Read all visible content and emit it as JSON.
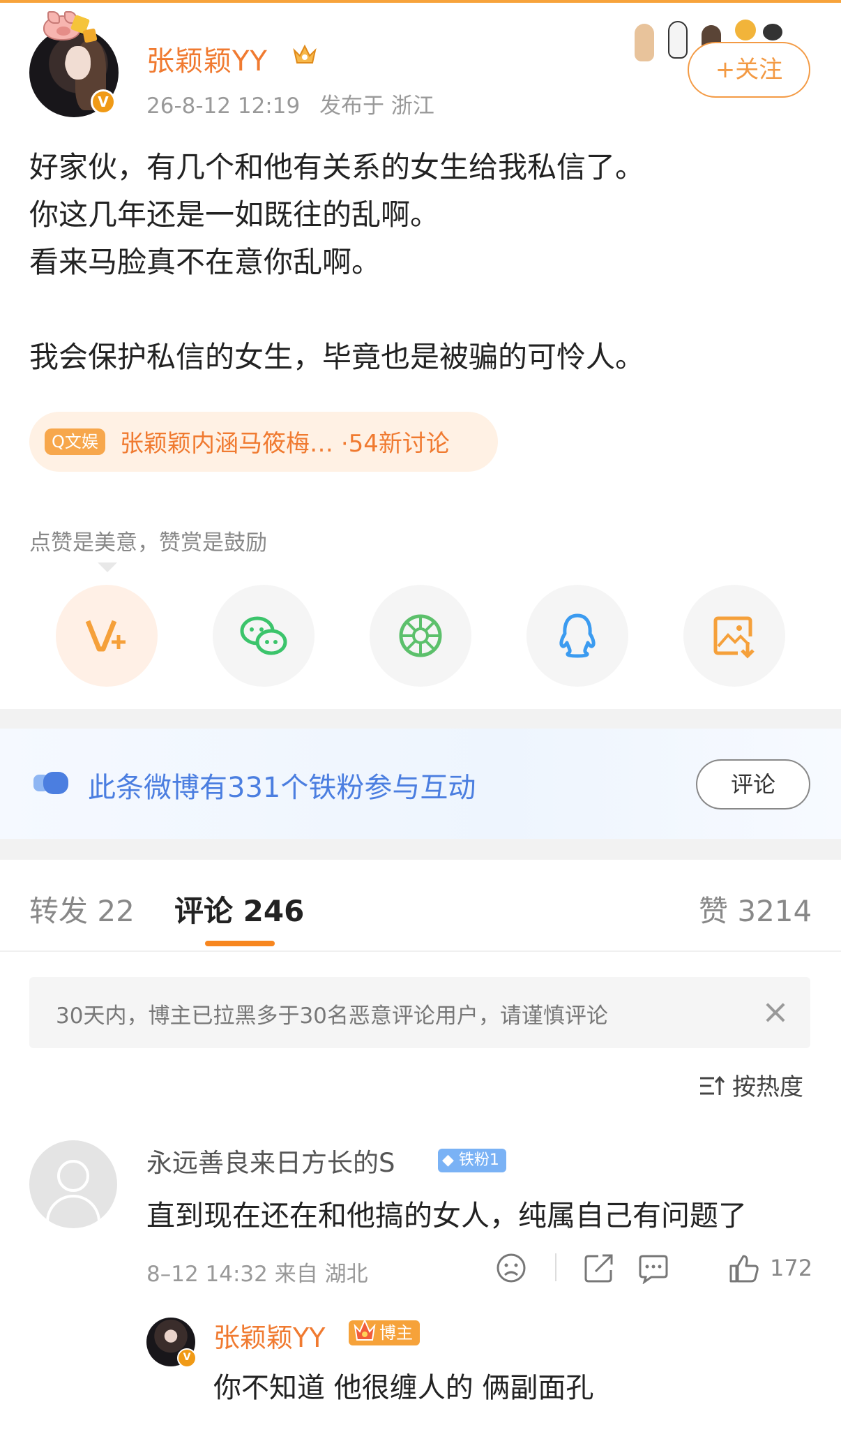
{
  "post": {
    "username": "张颖颖YY",
    "time": "26-8-12 12:19",
    "location": "发布于 浙江",
    "follow_label": "+关注",
    "lines": [
      "好家伙，有几个和他有关系的女生给我私信了。",
      "你这几年还是一如既往的乱啊。",
      "看来马脸真不在意你乱啊。",
      "我会保护私信的女生，毕竟也是被骗的可怜人。"
    ],
    "topic": {
      "tag": "Q文娱",
      "text": "张颖颖内涵马筱梅…",
      "count": "·54新讨论"
    },
    "reward_tip": "点赞是美意，赞赏是鼓励"
  },
  "share": {
    "icons": [
      "reward-v-plus-icon",
      "wechat-icon",
      "moments-icon",
      "qq-icon",
      "save-image-icon"
    ],
    "colors": {
      "reward": "#f5a03a",
      "wechat": "#3bc46b",
      "moments": "#5cc06b",
      "qq": "#3b9bf0",
      "save": "#f5a03a"
    }
  },
  "fan_banner": {
    "text": "此条微博有331个铁粉参与互动",
    "button": "评论"
  },
  "tabs": {
    "repost": "转发 22",
    "comment": "评论 246",
    "like": "赞 3214"
  },
  "notice": {
    "text": "30天内，博主已拉黑多于30名恶意评论用户，请谨慎评论",
    "close": "×"
  },
  "sort_label": "按热度",
  "comment": {
    "username": "永远善良来日方长的S",
    "badge": "铁粉1",
    "text": "直到现在还在和他搞的女人，纯属自己有问题了",
    "meta": "8–12 14:32 来自 湖北",
    "like_count": "172"
  },
  "reply": {
    "username": "张颖颖YY",
    "badge": "博主",
    "text": "你不知道 他很缠人的 俩副面孔"
  },
  "colors": {
    "accent": "#f07a30",
    "follow": "#f39a44",
    "link_blue": "#4b7ee0"
  }
}
